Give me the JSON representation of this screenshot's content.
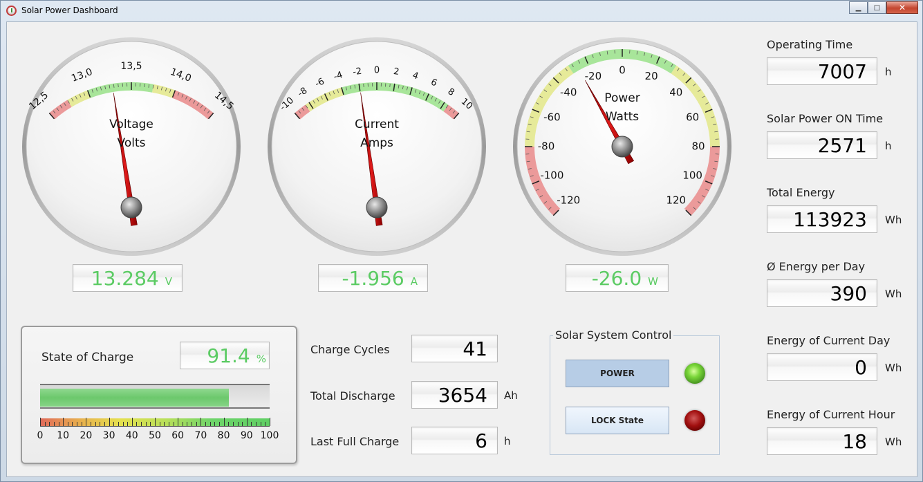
{
  "window": {
    "title": "Solar Power Dashboard"
  },
  "icons": {
    "app": "solar-app-icon",
    "minimize": "minimize-icon",
    "maximize": "maximize-icon",
    "close": "close-icon"
  },
  "gauges": {
    "voltage": {
      "label_line1": "Voltage",
      "label_line2": "Volts",
      "ticks": [
        "12,5",
        "13,0",
        "13,5",
        "14,0",
        "14,5"
      ],
      "min": 12.5,
      "max": 14.5,
      "value": 13.284,
      "display": "13.284",
      "unit": "V"
    },
    "current": {
      "label_line1": "Current",
      "label_line2": "Amps",
      "ticks": [
        "-10",
        "-8",
        "-6",
        "-4",
        "-2",
        "0",
        "2",
        "4",
        "6",
        "8",
        "10"
      ],
      "min": -10,
      "max": 10,
      "value": -1.956,
      "display": "-1.956",
      "unit": "A"
    },
    "power": {
      "label_line1": "Power",
      "label_line2": "Watts",
      "ticks": [
        "-120",
        "-100",
        "-80",
        "-60",
        "-40",
        "-20",
        "0",
        "20",
        "40",
        "60",
        "80",
        "100",
        "120"
      ],
      "min": -120,
      "max": 120,
      "value": -26.0,
      "display": "-26.0",
      "unit": "W"
    }
  },
  "state_of_charge": {
    "label": "State of Charge",
    "value": 91.4,
    "display": "91.4",
    "unit": "%",
    "scale_labels": [
      "0",
      "10",
      "20",
      "30",
      "40",
      "50",
      "60",
      "70",
      "80",
      "90",
      "100"
    ]
  },
  "battery_stats": [
    {
      "label": "Charge Cycles",
      "value": "41",
      "unit": ""
    },
    {
      "label": "Total Discharge",
      "value": "3654",
      "unit": "Ah"
    },
    {
      "label": "Last Full Charge",
      "value": "6",
      "unit": "h"
    }
  ],
  "control": {
    "title": "Solar System Control",
    "power_button": "POWER",
    "lock_button": "LOCK State",
    "power_led": "green",
    "lock_led": "red"
  },
  "stats": [
    {
      "label": "Operating Time",
      "value": "7007",
      "unit": "h"
    },
    {
      "label": "Solar Power ON Time",
      "value": "2571",
      "unit": "h"
    },
    {
      "label": "Total Energy",
      "value": "113923",
      "unit": "Wh"
    },
    {
      "label": "Ø Energy per Day",
      "value": "390",
      "unit": "Wh"
    },
    {
      "label": "Energy of Current Day",
      "value": "0",
      "unit": "Wh"
    },
    {
      "label": "Energy of Current Hour",
      "value": "18",
      "unit": "Wh"
    }
  ]
}
